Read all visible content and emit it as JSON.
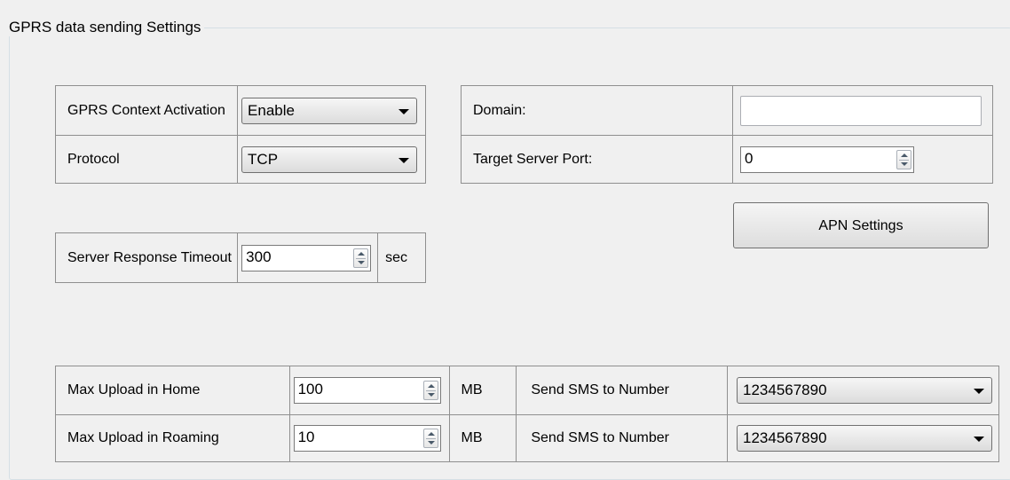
{
  "group": {
    "title": "GPRS  data sending Settings"
  },
  "gprs": {
    "context_label": "GPRS Context Activation",
    "context_value": "Enable",
    "protocol_label": "Protocol",
    "protocol_value": "TCP"
  },
  "server": {
    "domain_label": "Domain:",
    "domain_value": "",
    "port_label": "Target Server Port:",
    "port_value": "0",
    "apn_button": "APN Settings"
  },
  "timeout": {
    "label": "Server Response Timeout",
    "value": "300",
    "unit": "sec"
  },
  "upload": {
    "rows": [
      {
        "label": "Max Upload in Home",
        "value": "100",
        "unit": "MB",
        "sms_label": "Send SMS to Number",
        "sms_value": "1234567890"
      },
      {
        "label": "Max Upload in Roaming",
        "value": "10",
        "unit": "MB",
        "sms_label": "Send SMS to Number",
        "sms_value": "1234567890"
      }
    ]
  }
}
